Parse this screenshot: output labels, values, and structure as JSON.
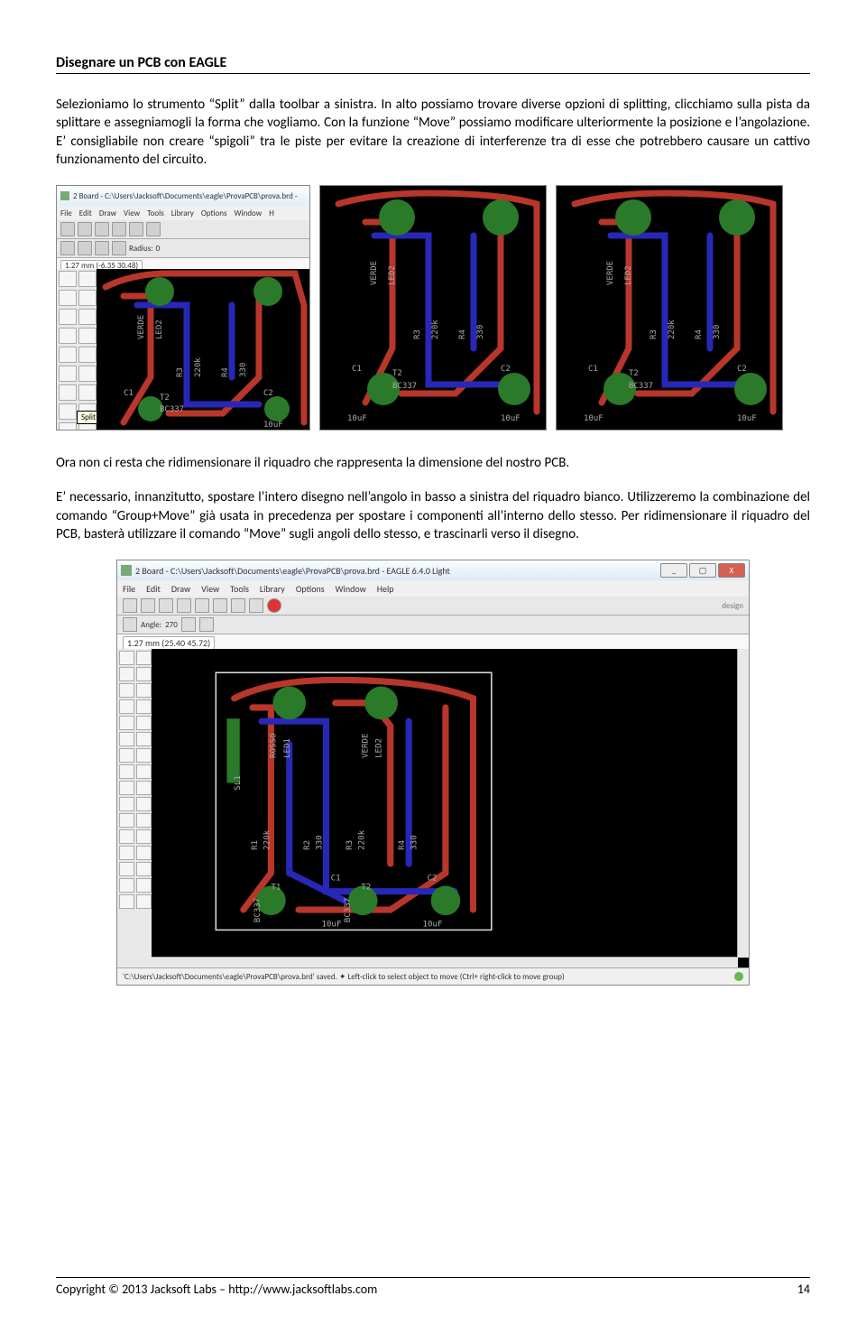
{
  "header": {
    "title": "Disegnare un PCB con EAGLE"
  },
  "para1": "Selezioniamo lo strumento “Split” dalla toolbar a sinistra. In alto possiamo trovare diverse opzioni di splitting, clicchiamo sulla pista da splittare e assegniamogli la forma che vogliamo. Con la funzione “Move” possiamo modificare ulteriormente la posizione e l’angolazione. E’ consigliabile non creare “spigoli” tra le piste per evitare la creazione di interferenze tra di esse che potrebbero causare un cattivo funzionamento del circuito.",
  "para2": "Ora non ci resta che ridimensionare il riquadro che rappresenta la dimensione del nostro PCB.",
  "para3": "E’ necessario, innanzitutto, spostare l’intero disegno nell’angolo in basso a sinistra del riquadro bianco. Utilizzeremo la combinazione del comando “Group+Move” già usata in precedenza per spostare i componenti all’interno dello stesso. Per ridimensionare il riquadro del PCB, basterà utilizzare il comando “Move” sugli angoli dello stesso, e trascinarli verso il disegno.",
  "shot1": {
    "title_prefix": "2 Board - C:\\Users\\Jacksoft\\Documents\\eagle\\ProvaPCB\\prova.brd -",
    "menus": [
      "File",
      "Edit",
      "Draw",
      "View",
      "Tools",
      "Library",
      "Options",
      "Window",
      "H"
    ],
    "radius_label": "Radius:",
    "radius_value": "0",
    "grid_value": "1.27 mm (-6.35 30.48)",
    "tooltip": "Split"
  },
  "pcb_labels": {
    "verde": "VERDE",
    "led2": "LED2",
    "rosso": "ROSSO",
    "led1": "LED1",
    "sl1": "SL1",
    "r1": "R1",
    "r2": "R2",
    "r3": "R3",
    "r4": "R4",
    "v220k": "220k",
    "v330": "330",
    "c1": "C1",
    "c2": "C2",
    "t1": "T1",
    "t2": "T2",
    "bc337": "BC337",
    "tenuf": "10uF"
  },
  "bigshot": {
    "title": "2 Board - C:\\Users\\Jacksoft\\Documents\\eagle\\ProvaPCB\\prova.brd - EAGLE 6.4.0 Light",
    "menus": [
      "File",
      "Edit",
      "Draw",
      "View",
      "Tools",
      "Library",
      "Options",
      "Window",
      "Help"
    ],
    "angle_label": "Angle:",
    "angle_value": "270",
    "coords": "1.27 mm (25.40 45.72)",
    "status": "'C:\\Users\\Jacksoft\\Documents\\eagle\\ProvaPCB\\prova.brd' saved.   ✦ Left-click to select object to move (Ctrl+ right-click to move group)"
  },
  "footer": {
    "copyright": "Copyright © 2013  Jacksoft Labs – http://www.jacksoftlabs.com",
    "page": "14"
  }
}
